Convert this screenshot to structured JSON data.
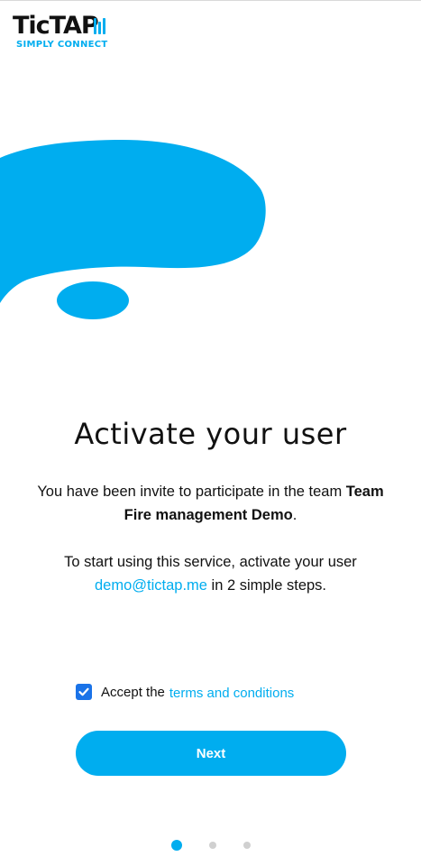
{
  "logo": {
    "word": "TicTAP",
    "tagline": "SIMPLY CONNECT",
    "brand_color": "#00adef"
  },
  "main": {
    "title": "Activate your user",
    "invite_prefix": "You have been invite to participate in the team ",
    "team_name": "Team Fire management Demo",
    "invite_suffix": ".",
    "start_prefix": "To start using this service, activate your user ",
    "email": "demo@tictap.me",
    "start_suffix": " in 2 simple steps."
  },
  "accept": {
    "checked": true,
    "label": "Accept the",
    "terms_link": "terms and conditions"
  },
  "next_button": {
    "label": "Next"
  },
  "pagination": {
    "total": 3,
    "active": 1
  },
  "colors": {
    "accent": "#00adef",
    "checkbox": "#1a73e8",
    "dot_inactive": "#d0d0d0"
  }
}
